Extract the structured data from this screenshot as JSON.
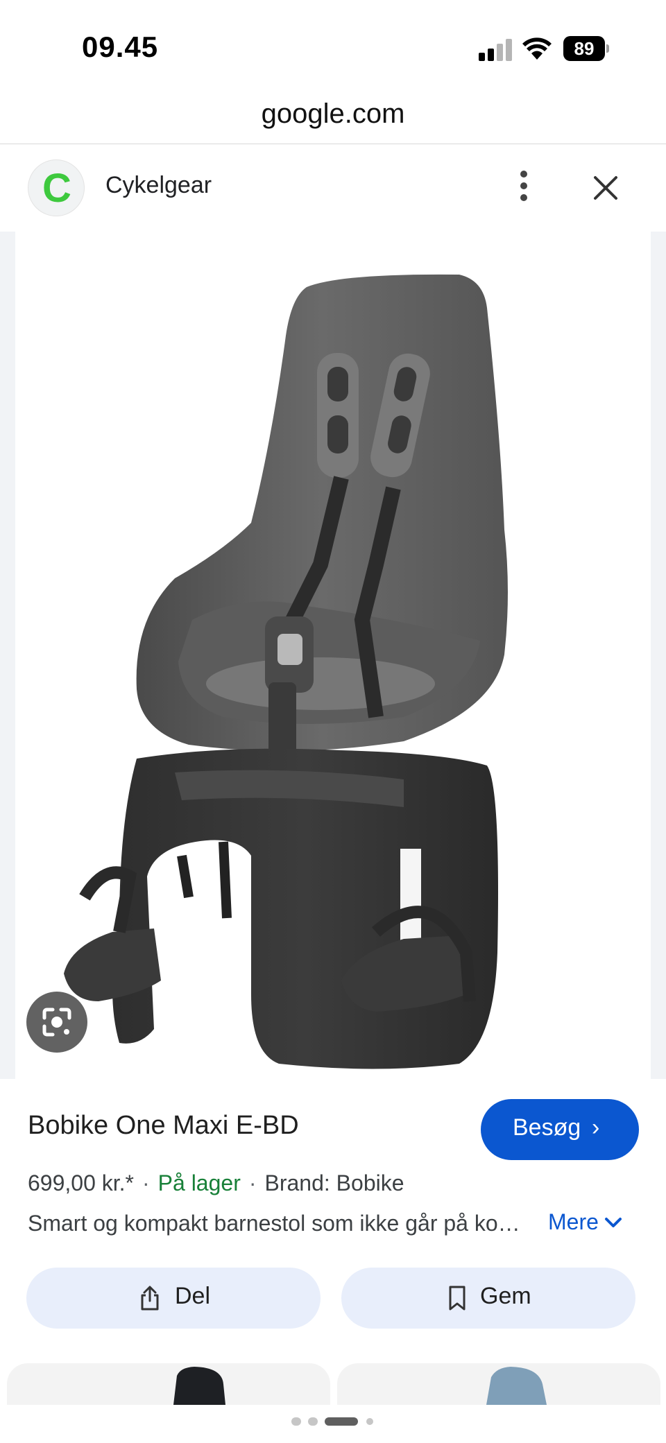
{
  "status_bar": {
    "time": "09.45",
    "battery": "89"
  },
  "browser": {
    "url": "google.com"
  },
  "site": {
    "logo_letter": "C",
    "name": "Cykelgear"
  },
  "product": {
    "title": "Bobike One Maxi E-BD",
    "price": "699,00 kr.*",
    "stock": "På lager",
    "brand": "Brand: Bobike",
    "description": "Smart og kompakt barnestol som ikke går på kompromis med komfort og sikkerhed",
    "more_label": "Mere"
  },
  "actions": {
    "visit_label": "Besøg",
    "share_label": "Del",
    "save_label": "Gem"
  },
  "colors": {
    "accent": "#0b57d0",
    "stock_green": "#188038",
    "button_bg": "#e8eefb"
  },
  "carousel": {
    "page_count": 4,
    "active_index": 2
  }
}
